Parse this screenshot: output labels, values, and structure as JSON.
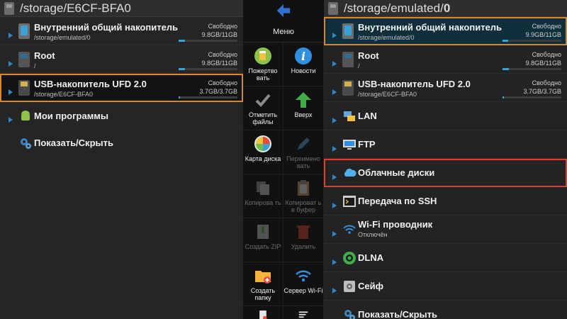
{
  "left": {
    "path": "/storage/E6CF-BFA0",
    "items": [
      {
        "title": "Внутренний общий накопитель",
        "subtitle": "/storage/emulated/0",
        "free_label": "Свободно",
        "size": "9.8GB/11GB",
        "used": 0.11
      },
      {
        "title": "Root",
        "subtitle": "/",
        "free_label": "Свободно",
        "size": "9.8GB/11GB",
        "used": 0.11
      },
      {
        "title": "USB-накопитель UFD 2.0",
        "subtitle": "/storage/E6CF-BFA0",
        "free_label": "Свободно",
        "size": "3.7GB/3.7GB",
        "used": 0.02
      },
      {
        "title": "Мои программы"
      },
      {
        "title": "Показать/Скрыть"
      }
    ]
  },
  "menu": {
    "title": "Меню",
    "tools": [
      {
        "label": "Пожертво вать",
        "icon": "beer-icon",
        "enabled": true
      },
      {
        "label": "Новости",
        "icon": "info-icon",
        "enabled": true
      },
      {
        "label": "Отметить файлы",
        "icon": "check-icon",
        "enabled": true
      },
      {
        "label": "Вверх",
        "icon": "up-arrow-icon",
        "enabled": true
      },
      {
        "label": "Карта диска",
        "icon": "pie-chart-icon",
        "enabled": true
      },
      {
        "label": "Переимено вать",
        "icon": "pencil-icon",
        "enabled": false
      },
      {
        "label": "Копирова ть",
        "icon": "copy-icon",
        "enabled": false
      },
      {
        "label": "Копироват ь в буфер",
        "icon": "clipboard-icon",
        "enabled": false
      },
      {
        "label": "Создать ZIP",
        "icon": "zip-icon",
        "enabled": false
      },
      {
        "label": "Удалить",
        "icon": "trash-icon",
        "enabled": false
      },
      {
        "label": "Создать папку",
        "icon": "new-folder-icon",
        "enabled": true
      },
      {
        "label": "Сервер Wi-Fi",
        "icon": "wifi-icon",
        "enabled": true
      }
    ]
  },
  "right": {
    "path_prefix": "/storage/emulated/",
    "path_suffix": "0",
    "items": [
      {
        "title": "Внутренний общий накопитель",
        "subtitle": "/storage/emulated/0",
        "free_label": "Свободно",
        "size": "9.9GB/11GB",
        "used": 0.1
      },
      {
        "title": "Root",
        "subtitle": "/",
        "free_label": "Свободно",
        "size": "9.8GB/11GB",
        "used": 0.11
      },
      {
        "title": "USB-накопитель UFD 2.0",
        "subtitle": "/storage/E6CF-BFA0",
        "free_label": "Свободно",
        "size": "3.7GB/3.7GB",
        "used": 0.02
      },
      {
        "title": "LAN"
      },
      {
        "title": "FTP"
      },
      {
        "title": "Облачные диски"
      },
      {
        "title": "Передача по SSH"
      },
      {
        "title": "Wi-Fi проводник",
        "subtitle": "Отключён"
      },
      {
        "title": "DLNA"
      },
      {
        "title": "Сейф"
      },
      {
        "title": "Показать/Скрыть"
      }
    ]
  },
  "colors": {
    "accent": "#2f87c8",
    "orange_highlight": "#d6892a",
    "red_highlight": "#e23b30"
  }
}
